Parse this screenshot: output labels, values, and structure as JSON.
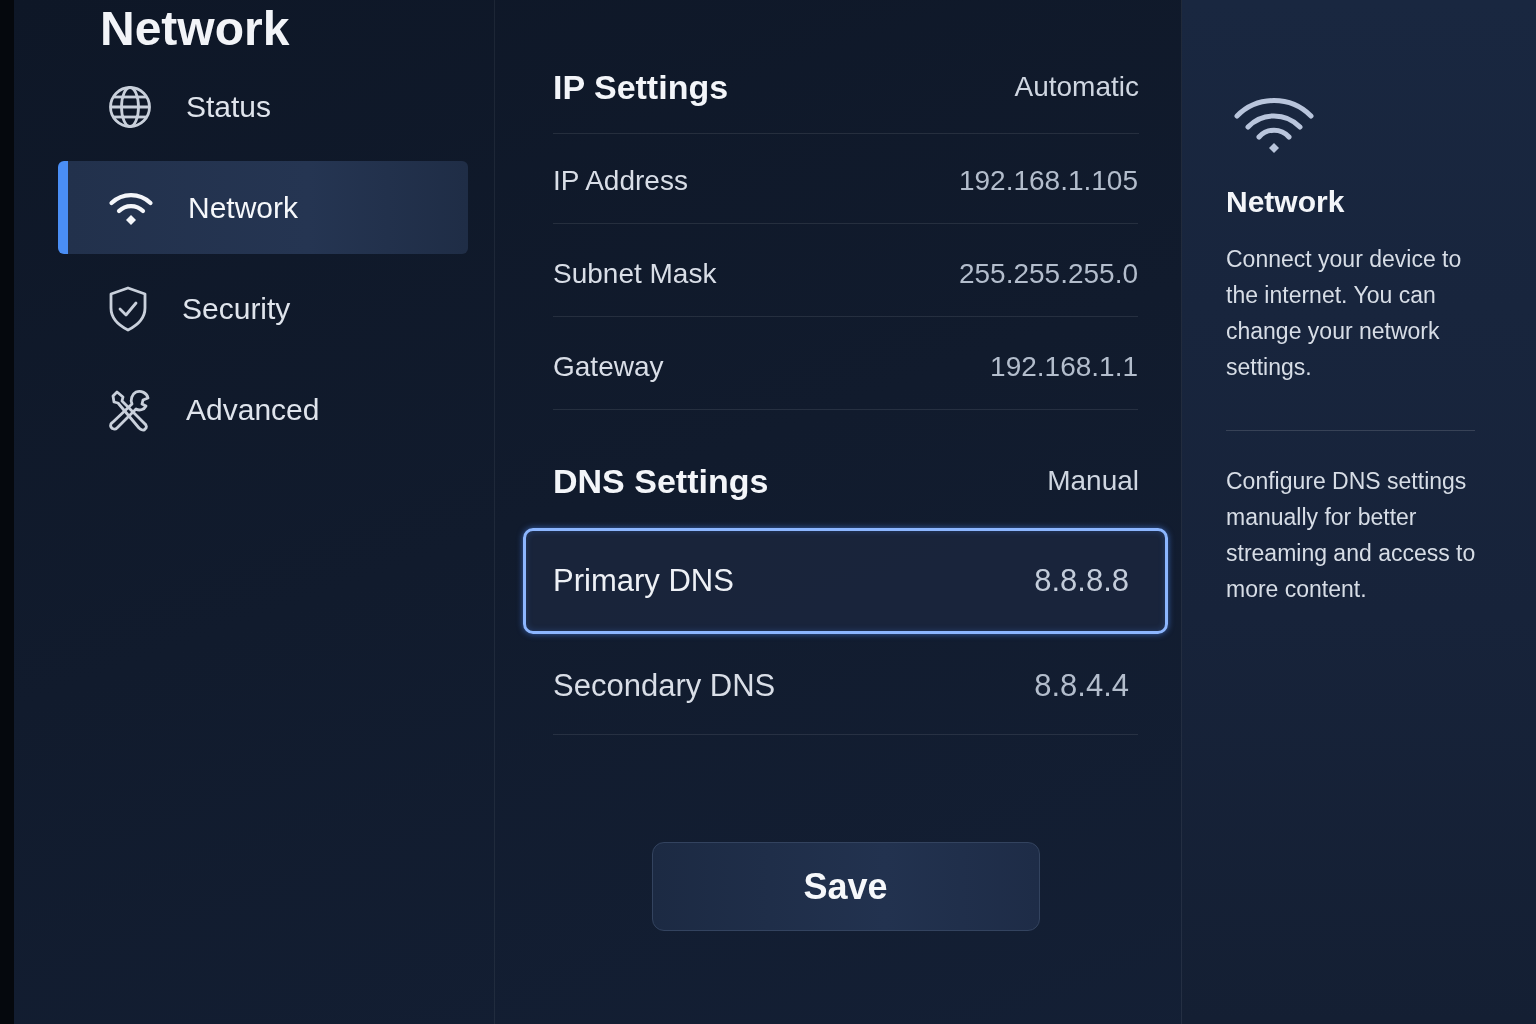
{
  "page_title": "Network",
  "sidebar": {
    "items": [
      {
        "label": "Status",
        "selected": false
      },
      {
        "label": "Network",
        "selected": true
      },
      {
        "label": "Security",
        "selected": false
      },
      {
        "label": "Advanced",
        "selected": false
      }
    ]
  },
  "sections": [
    {
      "title": "IP Settings",
      "mode": "Automatic",
      "rows": [
        {
          "label": "IP Address",
          "value": "192.168.1.105",
          "selected": false
        },
        {
          "label": "Subnet Mask",
          "value": "255.255.255.0",
          "selected": false
        },
        {
          "label": "Gateway",
          "value": "192.168.1.1",
          "selected": false
        }
      ]
    },
    {
      "title": "DNS Settings",
      "mode": "Manual",
      "rows": [
        {
          "label": "Primary DNS",
          "value": "8.8.8.8",
          "selected": true
        },
        {
          "label": "Secondary DNS",
          "value": "8.8.4.4",
          "selected": false
        }
      ]
    }
  ],
  "save_button": {
    "label": "Save"
  },
  "info_panel": {
    "title": "Network",
    "paragraphs": [
      "Connect your device to the internet. You can change your network settings.",
      "Configure DNS settings manually for better streaming and access to more content."
    ]
  }
}
